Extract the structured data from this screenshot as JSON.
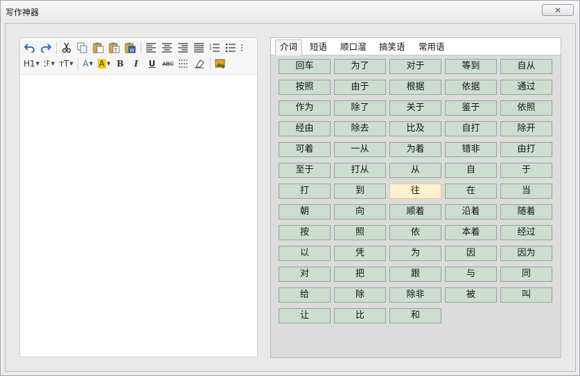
{
  "window": {
    "title": "写作神器",
    "close_label": "✕"
  },
  "toolbar": {
    "row1": [
      {
        "name": "undo-icon",
        "glyph": "↶",
        "color": "#2e6dbd"
      },
      {
        "name": "redo-icon",
        "glyph": "↷",
        "color": "#2e6dbd"
      },
      {
        "name": "cut-icon",
        "glyph": "✂",
        "color": "#444"
      },
      {
        "name": "copy-icon",
        "glyph": "⧉",
        "color": "#555"
      },
      {
        "name": "paste-icon",
        "glyph": "📋",
        "color": "#b08a3a"
      },
      {
        "name": "paste-text-icon",
        "glyph": "📋",
        "color": "#b08a3a"
      },
      {
        "name": "paste-word-icon",
        "glyph": "📋",
        "color": "#3a6ab0"
      }
    ],
    "row2": {
      "heading_label": "H1",
      "font_label": "ℱ",
      "size_label": "тT",
      "font_color_label": "A",
      "bg_color_label": "A",
      "bold_label": "B",
      "italic_label": "I",
      "underline_label": "U",
      "strike_label": "ABC"
    }
  },
  "tabs": [
    {
      "label": "介词",
      "active": true
    },
    {
      "label": "短语",
      "active": false
    },
    {
      "label": "顺口溜",
      "active": false
    },
    {
      "label": "搞笑语",
      "active": false
    },
    {
      "label": "常用语",
      "active": false
    }
  ],
  "words": [
    "回车",
    "为了",
    "对于",
    "等到",
    "自从",
    "按照",
    "由于",
    "根据",
    "依据",
    "通过",
    "作为",
    "除了",
    "关于",
    "鉴于",
    "依照",
    "经由",
    "除去",
    "比及",
    "自打",
    "除开",
    "可着",
    "一从",
    "为着",
    "错非",
    "由打",
    "至于",
    "打从",
    "从",
    "自",
    "于",
    "打",
    "到",
    "往",
    "在",
    "当",
    "朝",
    "向",
    "顺着",
    "沿着",
    "随着",
    "按",
    "照",
    "依",
    "本着",
    "经过",
    "以",
    "凭",
    "为",
    "因",
    "因为",
    "对",
    "把",
    "跟",
    "与",
    "同",
    "给",
    "除",
    "除非",
    "被",
    "叫",
    "让",
    "比",
    "和"
  ],
  "hovered_word": "往",
  "colors": {
    "button_bg": "#cdddd0",
    "button_border": "#8ea593",
    "hover_bg": "#fdf0cf"
  }
}
